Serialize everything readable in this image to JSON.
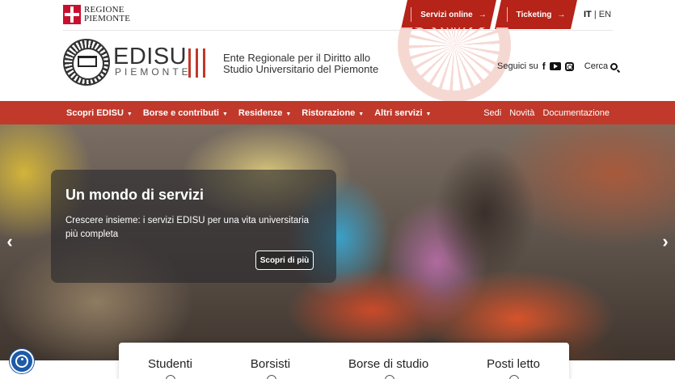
{
  "topbar": {
    "regione_line1": "REGIONE",
    "regione_line2": "PIEMONTE",
    "servizi_online": "Servizi online",
    "ticketing": "Ticketing",
    "arrow": "→",
    "lang_it": "IT",
    "lang_sep": "|",
    "lang_en": "EN"
  },
  "header": {
    "brand_name": "EDISU",
    "brand_sub": "PIEMONTE",
    "ente_line1": "Ente Regionale per il Diritto allo",
    "ente_line2": "Studio Universitario del Piemonte",
    "seguici": "Seguici su",
    "facebook_glyph": "f",
    "cerca": "Cerca"
  },
  "nav": {
    "left": [
      {
        "label": "Scopri EDISU"
      },
      {
        "label": "Borse e contributi"
      },
      {
        "label": "Residenze"
      },
      {
        "label": "Ristorazione"
      },
      {
        "label": "Altri servizi"
      }
    ],
    "caret": "▼",
    "right": [
      {
        "label": "Sedi"
      },
      {
        "label": "Novità"
      },
      {
        "label": "Documentazione"
      }
    ]
  },
  "hero": {
    "title": "Un mondo di servizi",
    "text": "Crescere insieme: i servizi EDISU per una vita universitaria più completa",
    "button": "Scopri di più",
    "prev": "‹",
    "next": "›"
  },
  "quick_links": [
    {
      "label": "Studenti"
    },
    {
      "label": "Borsisti"
    },
    {
      "label": "Borse di studio"
    },
    {
      "label": "Posti letto"
    }
  ],
  "colors": {
    "brand_red": "#c0392b",
    "tab_red": "#b52319",
    "accessibility_blue": "#1d5aa8"
  }
}
